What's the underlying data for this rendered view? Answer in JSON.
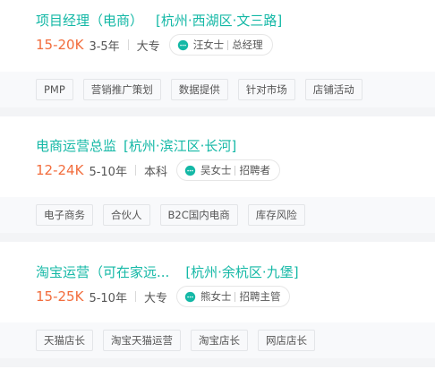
{
  "jobs": [
    {
      "title": "项目经理（电商）",
      "location": "[杭州·西湖区·文三路]",
      "salary": "15-20K",
      "experience": "3-5年",
      "education": "大专",
      "recruiter_name": "汪女士",
      "recruiter_role": "总经理",
      "tags": [
        "PMP",
        "营销推广策划",
        "数据提供",
        "针对市场",
        "店铺活动"
      ]
    },
    {
      "title": "电商运营总监",
      "location": "[杭州·滨江区·长河]",
      "salary": "12-24K",
      "experience": "5-10年",
      "education": "本科",
      "recruiter_name": "吴女士",
      "recruiter_role": "招聘者",
      "tags": [
        "电子商务",
        "合伙人",
        "B2C国内电商",
        "库存风险"
      ]
    },
    {
      "title": "淘宝运营（可在家远...",
      "location": "[杭州·余杭区·九堡]",
      "salary": "15-25K",
      "experience": "5-10年",
      "education": "大专",
      "recruiter_name": "熊女士",
      "recruiter_role": "招聘主管",
      "tags": [
        "天猫店长",
        "淘宝天猫运营",
        "淘宝店长",
        "网店店长"
      ]
    }
  ],
  "colors": {
    "accent": "#14b8a6",
    "salary": "#f26d3d",
    "background": "#f3f4f6"
  },
  "icons": {
    "recruiter_chat": "chat-bubble-icon"
  }
}
